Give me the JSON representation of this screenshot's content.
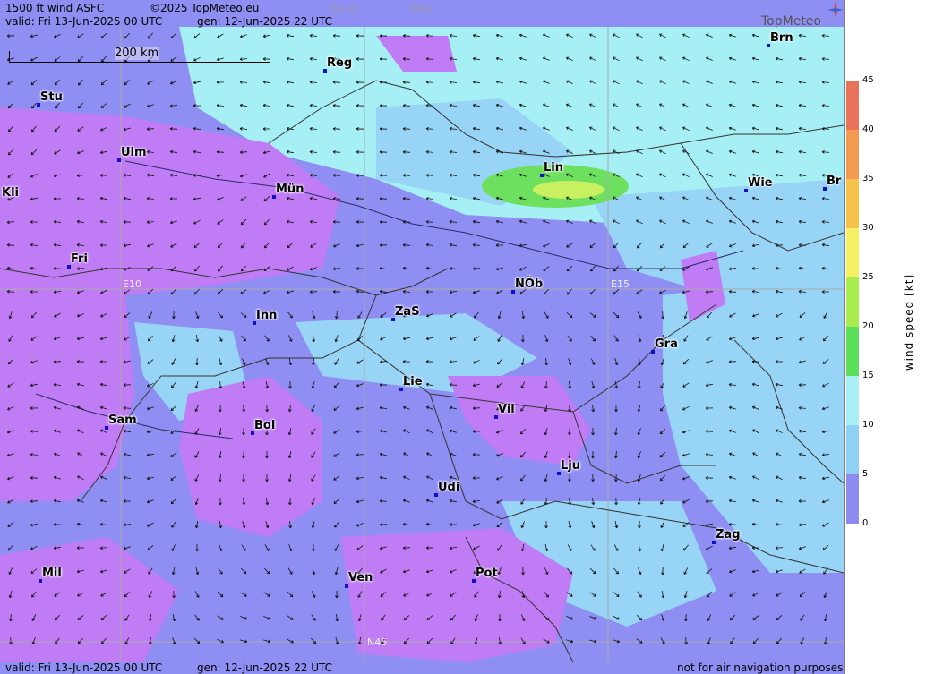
{
  "header": {
    "title": "1500 ft wind ASFC",
    "copyright": "©2025 TopMeteo.eu",
    "run_day": "Thu 18",
    "run_code": "9304",
    "valid": "valid:  Fri  13-Jun-2025  00 UTC",
    "gen": "gen: 12-Jun-2025 22 UTC",
    "logo": "TopMeteo"
  },
  "footer": {
    "valid": "valid:  Fri  13-Jun-2025  00 UTC",
    "gen": "gen: 12-Jun-2025 22 UTC",
    "disclaimer": "not for air navigation purposes"
  },
  "scale": {
    "label": "200 km"
  },
  "grid_labels": {
    "e10": "E10",
    "e15": "E15",
    "n45": "N45"
  },
  "cities": [
    {
      "name": "Brn"
    },
    {
      "name": "Reg"
    },
    {
      "name": "Stu"
    },
    {
      "name": "Ulm"
    },
    {
      "name": "Kli"
    },
    {
      "name": "Mün"
    },
    {
      "name": "Lin"
    },
    {
      "name": "Wie"
    },
    {
      "name": "Br"
    },
    {
      "name": "Fri"
    },
    {
      "name": "NÖb"
    },
    {
      "name": "ZaS"
    },
    {
      "name": "Inn"
    },
    {
      "name": "Gra"
    },
    {
      "name": "Lie"
    },
    {
      "name": "Vil"
    },
    {
      "name": "Sam"
    },
    {
      "name": "Bol"
    },
    {
      "name": "Lju"
    },
    {
      "name": "Udi"
    },
    {
      "name": "Zag"
    },
    {
      "name": "Mil"
    },
    {
      "name": "Pot"
    },
    {
      "name": "Ven"
    }
  ],
  "legend": {
    "title": "wind speed [kt]",
    "ticks": [
      "45",
      "40",
      "35",
      "30",
      "25",
      "20",
      "15",
      "10",
      "5",
      "0"
    ],
    "colors": [
      "#e8735a",
      "#f29a50",
      "#f5c24a",
      "#f5f064",
      "#a8ec50",
      "#5ce05a",
      "#a8f0f5",
      "#8fd0f5",
      "#8c8cf0",
      "#c080f5"
    ]
  }
}
